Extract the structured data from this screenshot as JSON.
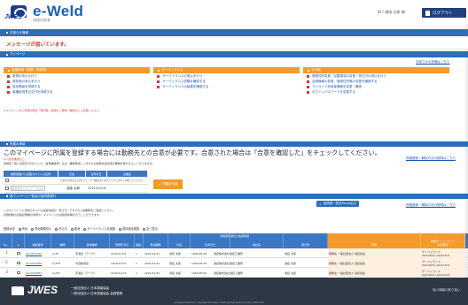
{
  "header": {
    "brand": "e-Weld",
    "brand_sub": "溶接技能者",
    "logo_text": "JWES",
    "user_info": "ID  /  溶接 太郎 様",
    "logout_label": "ログアウト"
  },
  "sections": {
    "notice_bar": "お知らせ情報",
    "notice_text": "メッセージが届いています。",
    "mypage_bar": "マイページ",
    "approval_bar": "所属の承認",
    "list_bar": "各マイページ一覧及び証明書発行"
  },
  "panels": [
    {
      "title": "各種申請（新規・再評価）",
      "links": [
        "新規の申込を行う",
        "再評価の申込を行う",
        "追加等級を申請する",
        "各種証明書の交付を申請する"
      ]
    },
    {
      "title": "サーベイランス",
      "links": [
        "サーベイランスの申込を行う",
        "サーベイランス書類を確認する",
        "サーベイランスの結果を確認する"
      ]
    },
    {
      "title": "その他",
      "links": [
        "登録住所変更、記載事項の変更・再交付の申込を行う",
        "会員情報の変更、登録住所等の変更を確認する",
        "マイページ利用者情報を変更・確認",
        "ログインパスワードを変更する"
      ]
    }
  ],
  "mypage_note": "※マイページをご利用の際は「発行者」情報をご登録・確認の上ご利用ください。",
  "help_links": {
    "mypage": "お知らせの詳細はこちら",
    "approval": "資格登録・解除方法の説明はこちら",
    "list": "資格登録・解除方法の説明はこちら"
  },
  "approval": {
    "title": "このマイページに所属を登録する場合には勤務先との合意が必要です。合意された場合は「合意を確認した」をチェックしてください。",
    "desc1": "※下記を確認の上、",
    "desc2": "登録完了後に合意が行われている（証明書番号）又は「書類発送」いずれかの勤務先担当者が書類を発行することができます。",
    "columns": [
      "勤務者届けに記載されている名称",
      "氏名",
      "生年月日",
      "企業名"
    ],
    "rows": [
      {
        "col1": "",
        "col2": "",
        "col3": "",
        "col4": "合意する場合は上記のチェック【確認済】を行ってからボタンを押してください。"
      },
      {
        "col1": "会社名を入力してください",
        "col2": "溶接 太郎",
        "col3": "2021/05/16",
        "col4": ""
      }
    ],
    "approve_label": "所属を承認"
  },
  "list": {
    "desc1": "このマイページに登録されている認証情報の一覧です。それぞれ公開期限をご確認ください。",
    "desc2": "評価試験の資格証明書の参照や、マイページの資格登録等を行うことができます。",
    "search_label": "証明書一覧をExcel出力",
    "status_label": "登録状況",
    "statuses": [
      "有効",
      "有効期限切れ",
      "停止中",
      "取消",
      "サーベイランス未実施",
      "再評価未実施",
      "全て表示"
    ],
    "group_label": "資格者登録及び会員情報",
    "columns": [
      "No.",
      "認証番号",
      "種類",
      "資格種類",
      "登録年月日",
      "継続",
      "有効期限",
      "氏名",
      "生年月日",
      "会社名",
      "発行者",
      "状態",
      "次回サーベイランス",
      "次回更新"
    ],
    "rows": [
      {
        "no": "1",
        "cert": "3A-0012345",
        "kind": "A-2F",
        "type": "手溶接（アーク）",
        "date": "2020/11/01",
        "count": "1",
        "expiry": "2021/12/31",
        "name": "溶接 太郎",
        "birth": "1991/05/16",
        "company": "溶接株式会社溶接工業所",
        "issuer": "溶接 太郎",
        "status": "勤務先 一般社団法人 溶接協会",
        "next1": "サーベイランス",
        "next2": "2021/09/01～2021/12/31"
      },
      {
        "no": "2",
        "cert": "3A-0023456",
        "kind": "A-2FH",
        "type": "半自動溶接",
        "date": "2020/11/01",
        "count": "1",
        "expiry": "2021/12/31",
        "name": "溶接 太郎",
        "birth": "1991/05/16",
        "company": "溶接株式会社溶接工業所",
        "issuer": "溶接 太郎",
        "status": "勤務先 一般社団法人 溶接協会",
        "next1": "サーベイランス",
        "next2": "2021/09/01～2021/12/31"
      },
      {
        "no": "3",
        "cert": "3A-0034567",
        "kind": "A-2FV",
        "type": "手溶接（アーク）",
        "date": "2020/11/01",
        "count": "1",
        "expiry": "2021/12/31",
        "name": "溶接 太郎",
        "birth": "1991/05/16",
        "company": "溶接株式会社溶接工業所",
        "issuer": "溶接 太郎",
        "status": "勤務先 一般社団法人 溶接協会",
        "next1": "サーベイランス",
        "next2": "2021/09/01～2021/12/31"
      }
    ]
  },
  "footer": {
    "logo_text": "JWES",
    "org1": "一般社団法人 日本溶接協会",
    "org2": "一般社団法人 日本溶接協会 会員登録",
    "copyright": "All Rights Reserved, Copyright The Japan Welding Engineering Society 2008-2021",
    "link": "個人情報の取り扱い"
  }
}
